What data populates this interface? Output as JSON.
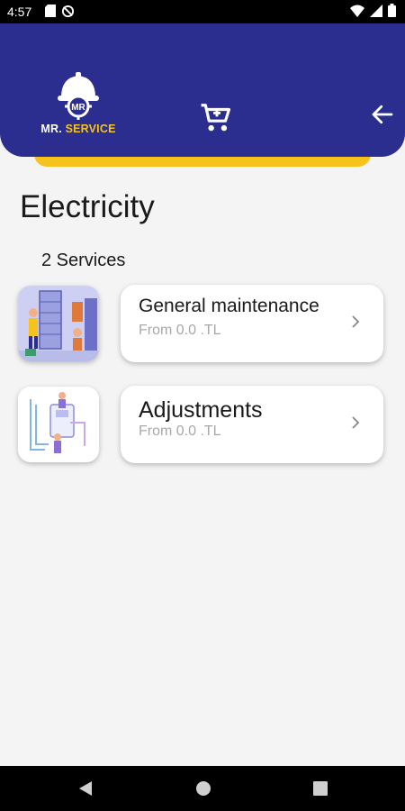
{
  "status_bar": {
    "time": "4:57",
    "icons": [
      "sd-card-icon",
      "sync-disabled-icon",
      "wifi-icon",
      "signal-icon",
      "battery-icon"
    ]
  },
  "header": {
    "logo_mark": "MR",
    "logo_text_1": "MR.",
    "logo_text_2": "SERVICE",
    "cart_icon": "cart-icon",
    "back_icon": "arrow-left-icon",
    "colors": {
      "primary": "#2b2e8f",
      "accent": "#f6c21c"
    }
  },
  "page": {
    "title": "Electricity",
    "count_label": "2 Services"
  },
  "services": [
    {
      "name": "General maintenance",
      "price": "From 0.0 .TL",
      "image": "electrician-panel-illustration"
    },
    {
      "name": "Adjustments",
      "price": "From 0.0 .TL",
      "image": "boiler-technician-illustration"
    }
  ],
  "nav_bar": {
    "icons": [
      "back-triangle-icon",
      "home-circle-icon",
      "recents-square-icon"
    ]
  }
}
